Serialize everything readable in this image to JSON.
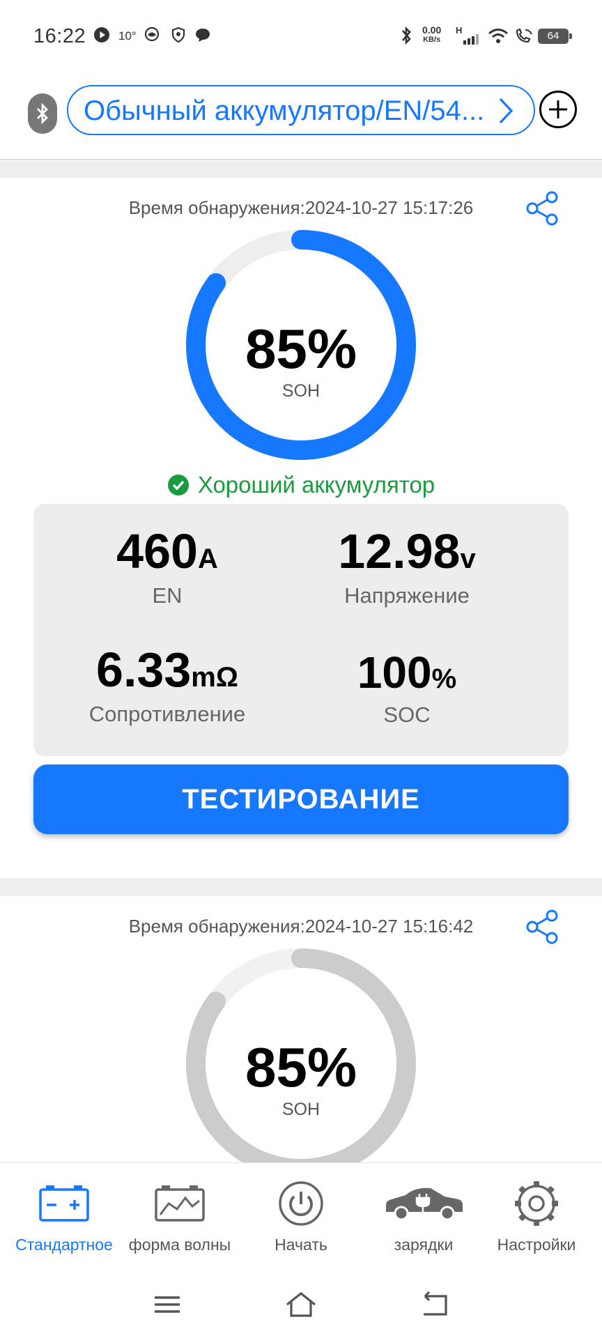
{
  "status_bar": {
    "time": "16:22",
    "temperature": "10°",
    "net_speed": "0.00",
    "net_unit": "KB/s",
    "signal_label": "H",
    "battery": "64"
  },
  "header": {
    "battery_type": "Обычный аккумулятор/EN/54..."
  },
  "results": [
    {
      "detection_time": "Время обнаружения:2024-10-27 15:17:26",
      "soh_value": "85%",
      "soh_label": "SOH",
      "soh_percent": 85,
      "gauge_color": "#1677ff",
      "status_text": "Хороший аккумулятор",
      "status_color": "#1a9c3e",
      "metrics": {
        "en": {
          "value": "460",
          "unit": "A",
          "label": "EN"
        },
        "voltage": {
          "value": "12.98",
          "unit": "v",
          "label": "Напряжение"
        },
        "resistance": {
          "value": "6.33",
          "unit": "mΩ",
          "label": "Сопротивление"
        },
        "soc": {
          "value": "100",
          "unit": "%",
          "label": "SOC"
        }
      },
      "test_button": "ТЕСТИРОВАНИЕ"
    },
    {
      "detection_time": "Время обнаружения:2024-10-27 15:16:42",
      "soh_value": "85%",
      "soh_label": "SOH",
      "soh_percent": 85,
      "gauge_color": "#cccccc"
    }
  ],
  "bottom_nav": [
    {
      "label": "Стандартное",
      "icon": "battery-icon",
      "active": true
    },
    {
      "label": "форма волны",
      "icon": "waveform-icon",
      "active": false
    },
    {
      "label": "Начать",
      "icon": "power-icon",
      "active": false
    },
    {
      "label": "зарядки",
      "icon": "car-charging-icon",
      "active": false
    },
    {
      "label": "Настройки",
      "icon": "gear-icon",
      "active": false
    }
  ],
  "colors": {
    "accent": "#1677ff",
    "good": "#1a9c3e",
    "gauge_track": "#eeeeee",
    "gauge_inactive": "#cccccc"
  }
}
